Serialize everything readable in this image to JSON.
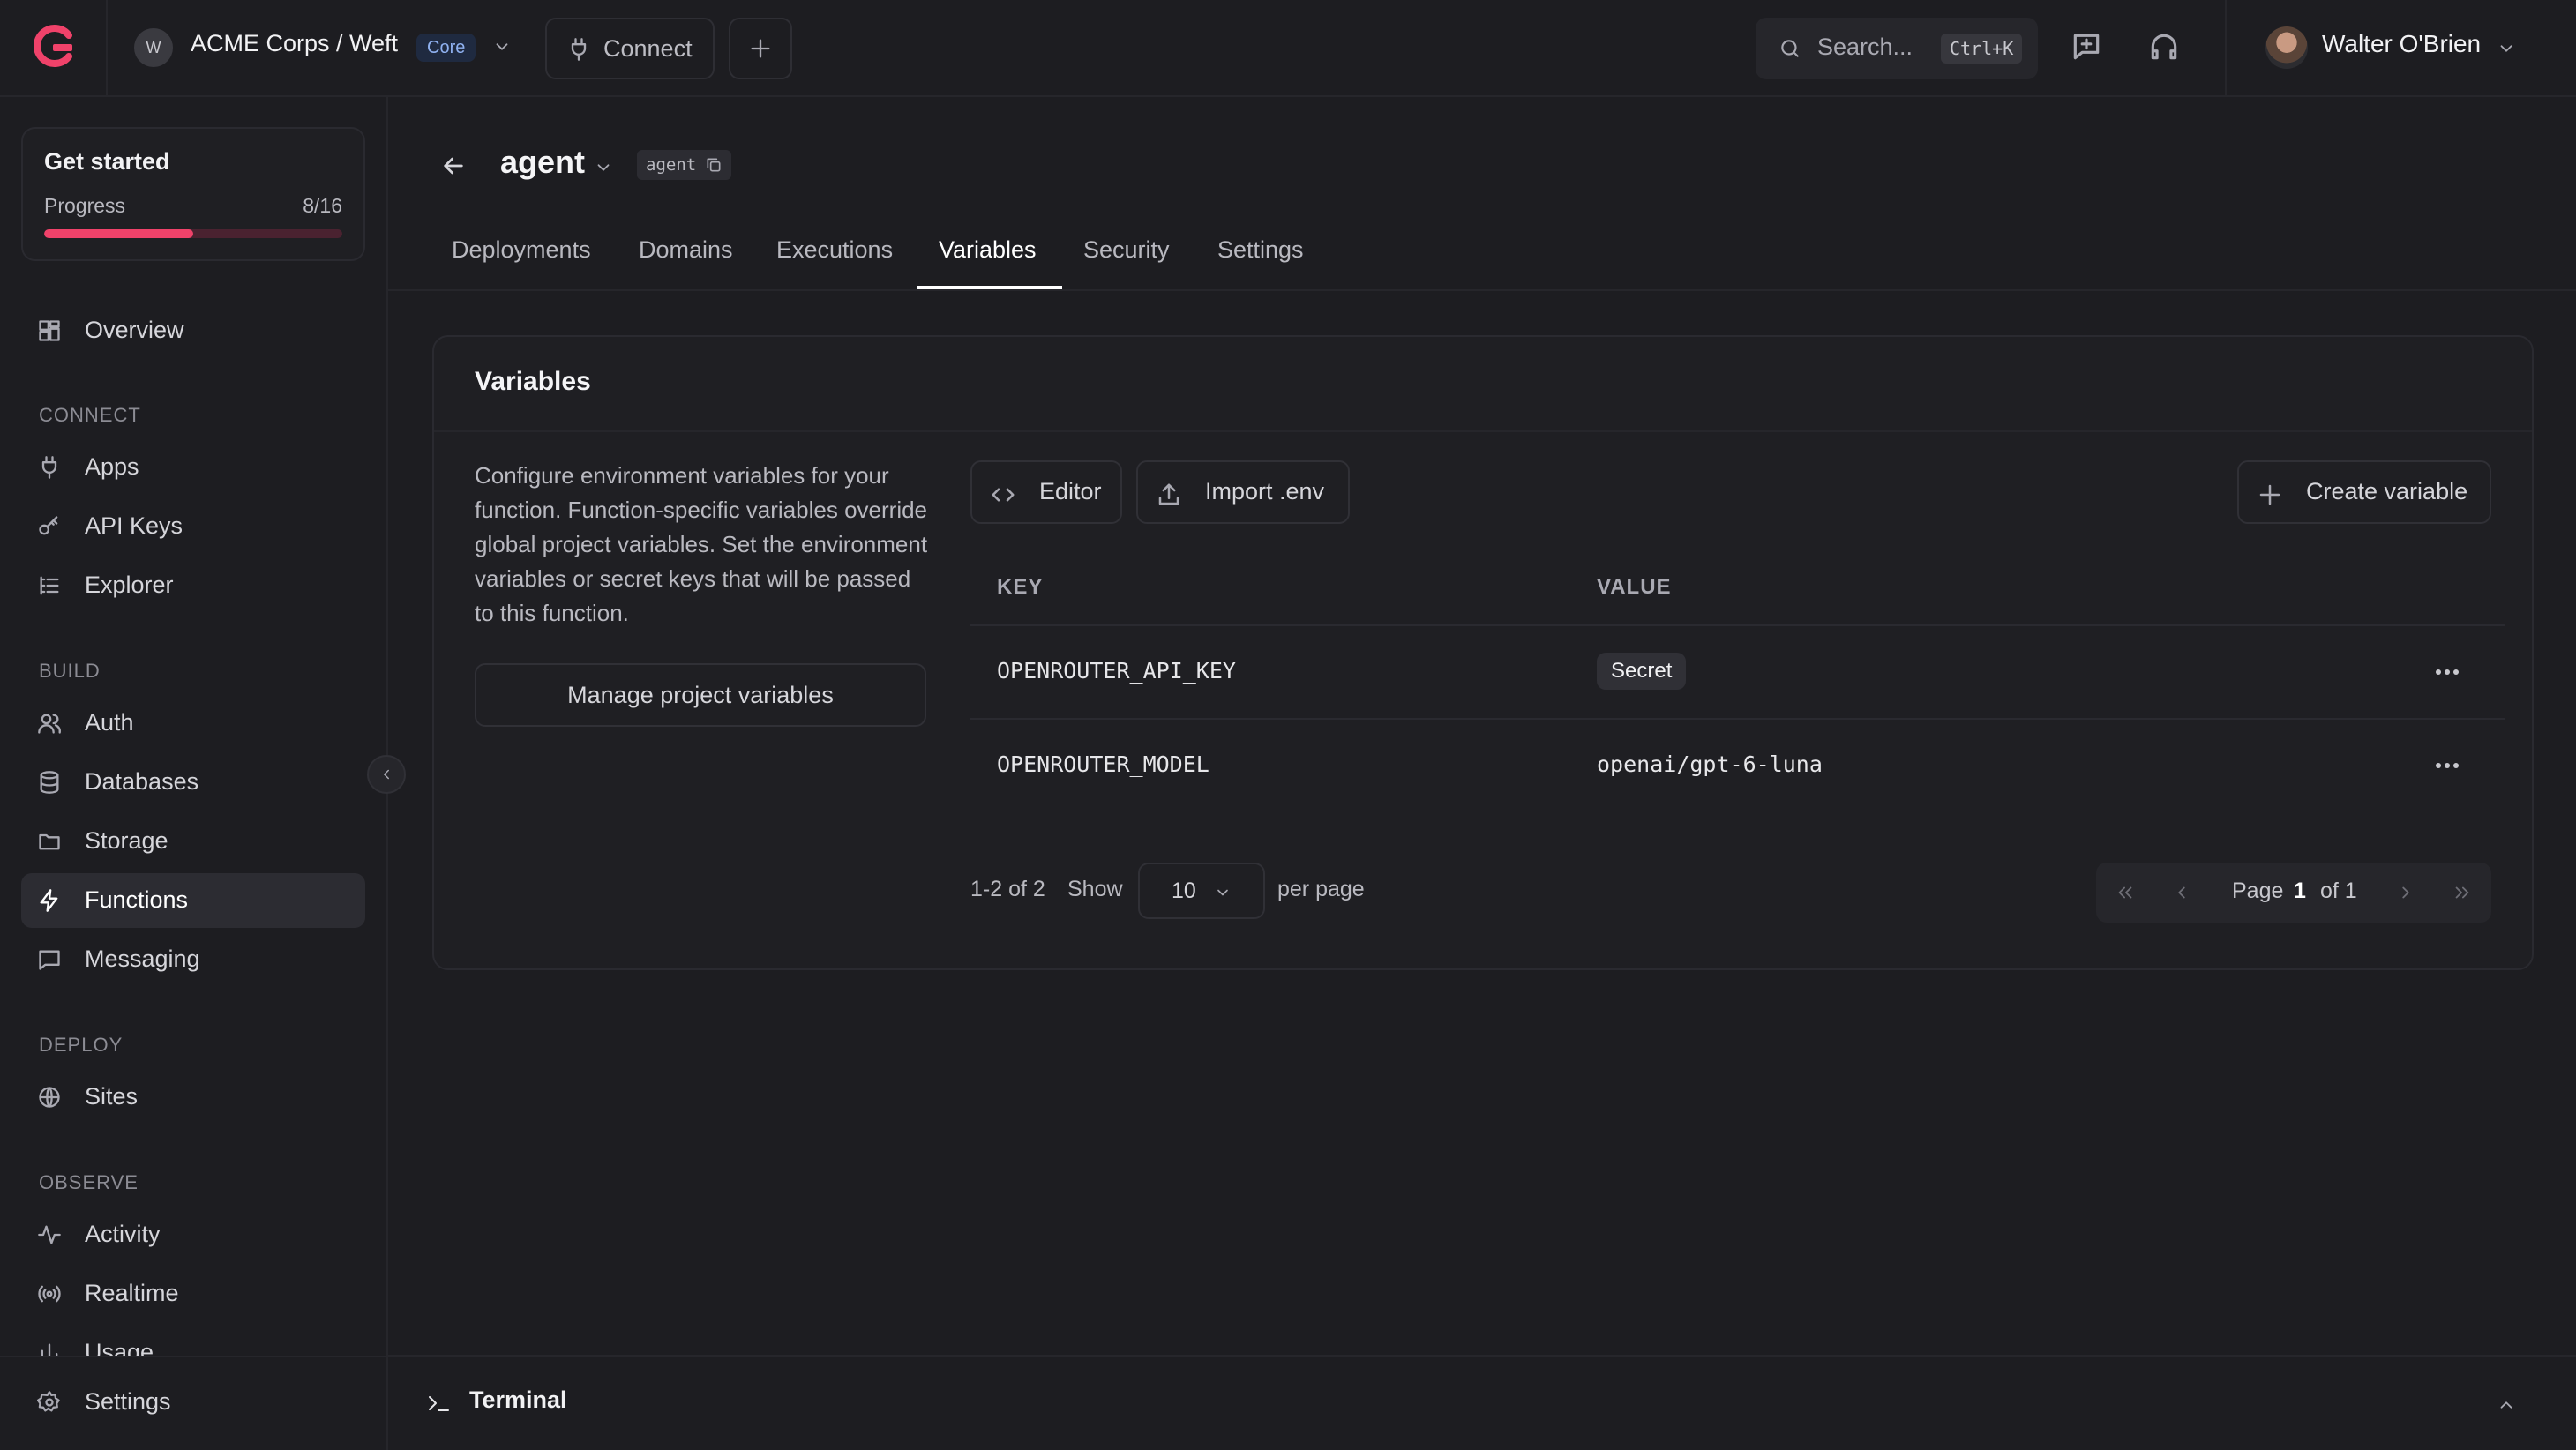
{
  "header": {
    "org_initial": "W",
    "org_name": "ACME Corps / Weft",
    "plan_badge": "Core",
    "connect_label": "Connect",
    "search_placeholder": "Search...",
    "search_shortcut": "Ctrl+K",
    "user_name": "Walter O'Brien"
  },
  "get_started": {
    "title": "Get started",
    "progress_label": "Progress",
    "progress_text": "8/16",
    "progress_fraction": 0.5
  },
  "sidebar": {
    "overview": "Overview",
    "sections": {
      "connect": "CONNECT",
      "build": "BUILD",
      "deploy": "DEPLOY",
      "observe": "OBSERVE"
    },
    "items": {
      "apps": "Apps",
      "api_keys": "API Keys",
      "explorer": "Explorer",
      "auth": "Auth",
      "databases": "Databases",
      "storage": "Storage",
      "functions": "Functions",
      "messaging": "Messaging",
      "sites": "Sites",
      "activity": "Activity",
      "realtime": "Realtime",
      "usage": "Usage"
    },
    "settings": "Settings"
  },
  "function": {
    "name": "agent",
    "id": "agent"
  },
  "tabs": {
    "deployments": "Deployments",
    "domains": "Domains",
    "executions": "Executions",
    "variables": "Variables",
    "security": "Security",
    "settings": "Settings"
  },
  "variables_card": {
    "title": "Variables",
    "description": "Configure environment variables for your function. Function-specific variables override global project variables. Set the environment variables or secret keys that will be passed to this function.",
    "manage_button": "Manage project variables",
    "editor_button": "Editor",
    "import_button": "Import .env",
    "create_button": "Create variable",
    "columns": {
      "key": "KEY",
      "value": "VALUE"
    },
    "rows": [
      {
        "key": "OPENROUTER_API_KEY",
        "value": "Secret"
      },
      {
        "key": "OPENROUTER_MODEL",
        "value": "openai/gpt-6-luna"
      }
    ],
    "pagination": {
      "count": "1-2 of 2",
      "show": "Show",
      "per_page_value": "10",
      "per_page": "per page",
      "page_label": "Page",
      "page_current": "1",
      "page_total": "of 1"
    }
  },
  "terminal": {
    "label": "Terminal"
  },
  "colors": {
    "background": "#1d1d21",
    "accent": "#f0426a",
    "card": "#1f1f23"
  }
}
